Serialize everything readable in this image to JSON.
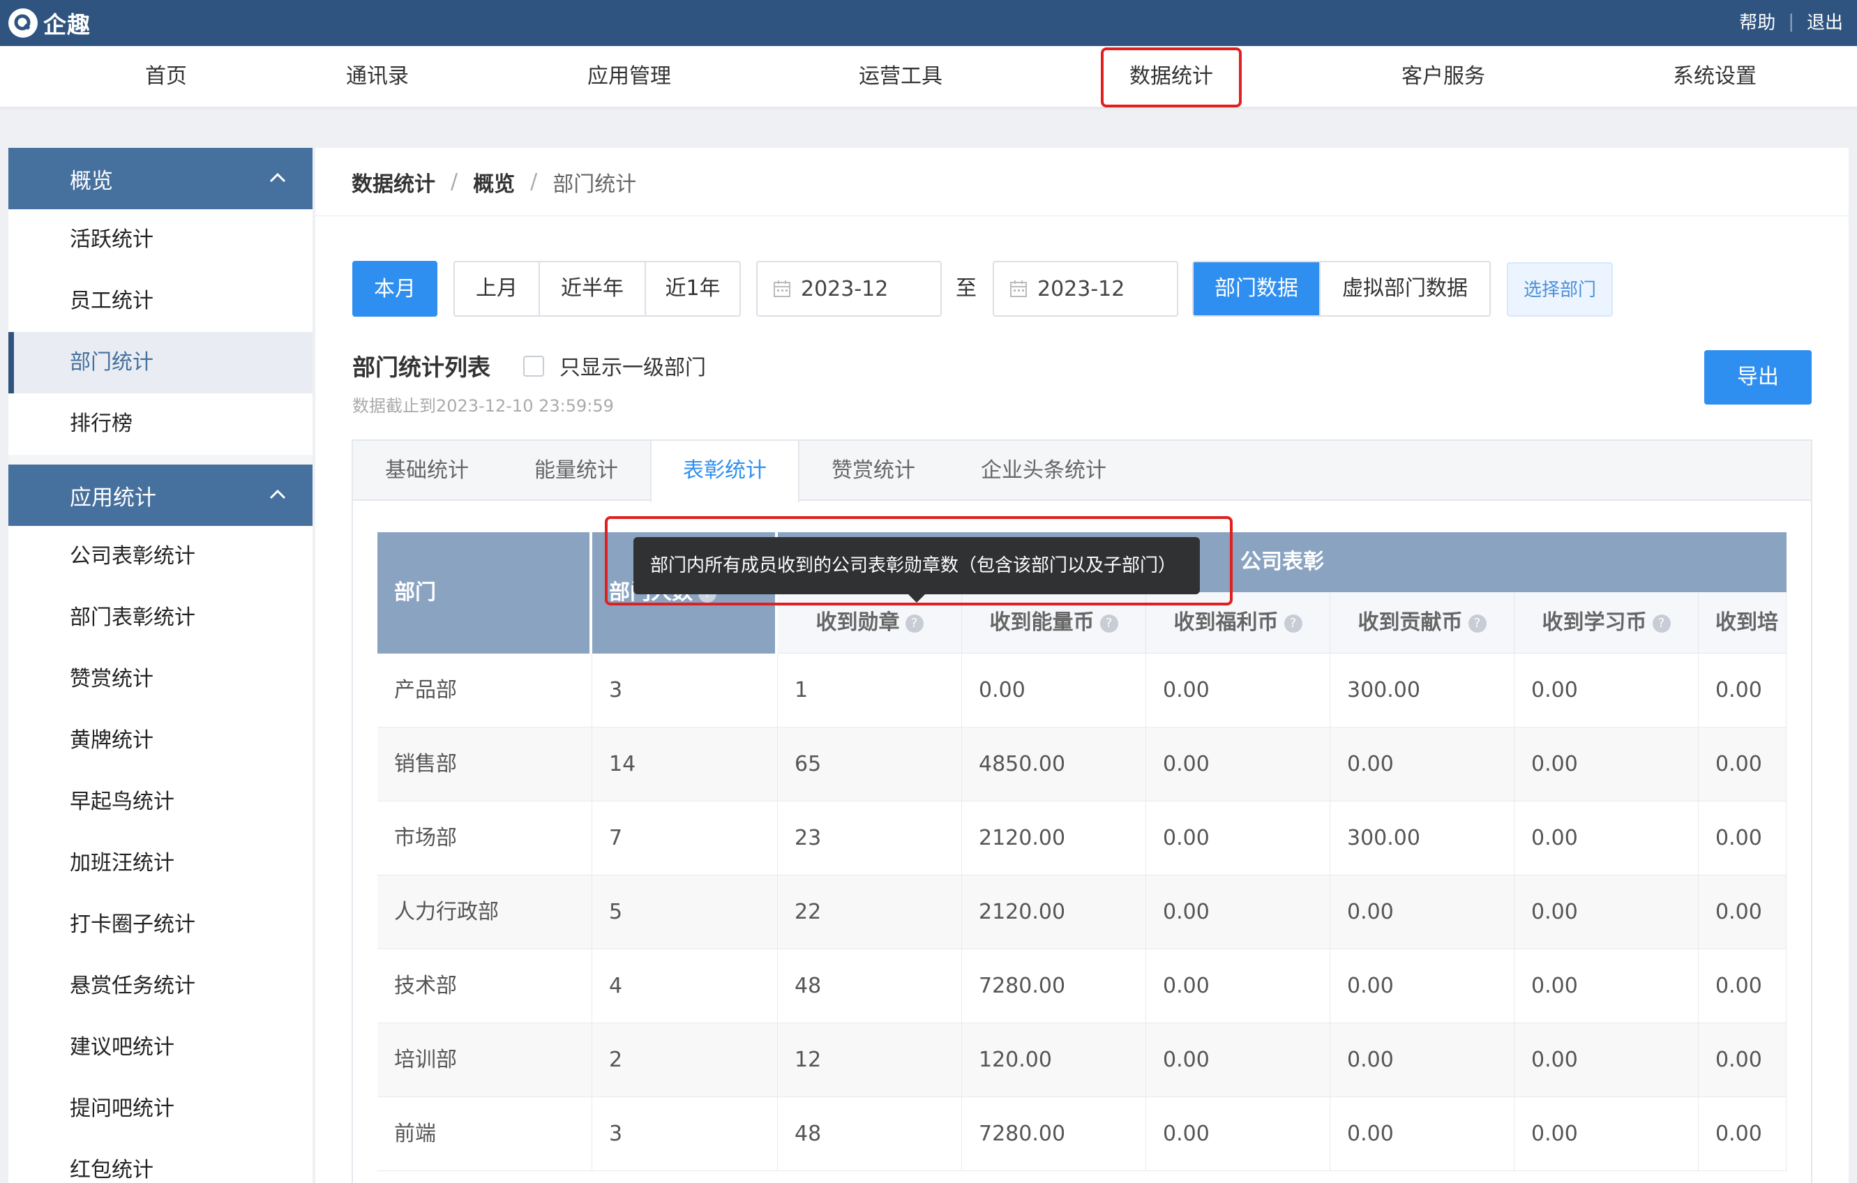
{
  "app": {
    "name": "企趣"
  },
  "top_links": {
    "help": "帮助",
    "sep": "|",
    "logout": "退出"
  },
  "nav": {
    "items": [
      "首页",
      "通讯录",
      "应用管理",
      "运营工具",
      "数据统计",
      "客户服务",
      "系统设置"
    ],
    "active": "数据统计"
  },
  "sidebar": {
    "group1": {
      "label": "概览",
      "items": [
        "活跃统计",
        "员工统计",
        "部门统计",
        "排行榜"
      ]
    },
    "group2": {
      "label": "应用统计",
      "items": [
        "公司表彰统计",
        "部门表彰统计",
        "赞赏统计",
        "黄牌统计",
        "早起鸟统计",
        "加班汪统计",
        "打卡圈子统计",
        "悬赏任务统计",
        "建议吧统计",
        "提问吧统计",
        "红包统计"
      ]
    },
    "active": "部门统计"
  },
  "breadcrumb": {
    "level1": "数据统计",
    "sep": "/",
    "level2": "概览",
    "current": "部门统计"
  },
  "filters": {
    "this_month": "本月",
    "ranges": [
      "上月",
      "近半年",
      "近1年"
    ],
    "date_from": "2023-12",
    "to_label": "至",
    "date_to": "2023-12",
    "source_tabs": [
      "部门数据",
      "虚拟部门数据"
    ],
    "select_dept": "选择部门"
  },
  "list": {
    "title": "部门统计列表",
    "checkbox_label": "只显示一级部门",
    "as_of": "数据截止到2023-12-10 23:59:59",
    "export": "导出"
  },
  "tabs": {
    "items": [
      "基础统计",
      "能量统计",
      "表彰统计",
      "赞赏统计",
      "企业头条统计"
    ],
    "active": "表彰统计"
  },
  "table": {
    "col_dept": "部门",
    "col_count": "部门人数",
    "group": "公司表彰",
    "sub_cols": [
      "收到勋章",
      "收到能量币",
      "收到福利币",
      "收到贡献币",
      "收到学习币",
      "收到培"
    ],
    "rows": [
      [
        "产品部",
        "3",
        "1",
        "0.00",
        "0.00",
        "300.00",
        "0.00",
        "0.00"
      ],
      [
        "销售部",
        "14",
        "65",
        "4850.00",
        "0.00",
        "0.00",
        "0.00",
        "0.00"
      ],
      [
        "市场部",
        "7",
        "23",
        "2120.00",
        "0.00",
        "300.00",
        "0.00",
        "0.00"
      ],
      [
        "人力行政部",
        "5",
        "22",
        "2120.00",
        "0.00",
        "0.00",
        "0.00",
        "0.00"
      ],
      [
        "技术部",
        "4",
        "48",
        "7280.00",
        "0.00",
        "0.00",
        "0.00",
        "0.00"
      ],
      [
        "培训部",
        "2",
        "12",
        "120.00",
        "0.00",
        "0.00",
        "0.00",
        "0.00"
      ],
      [
        "前端",
        "3",
        "48",
        "7280.00",
        "0.00",
        "0.00",
        "0.00",
        "0.00"
      ]
    ]
  },
  "tooltip": {
    "text": "部门内所有成员收到的公司表彰勋章数（包含该部门以及子部门）"
  },
  "colors": {
    "topbar": "#2f5480",
    "primary": "#2f8ff0",
    "sidebar_group": "#46709d",
    "table_header": "#8aa3c1",
    "highlight": "#e02020"
  }
}
